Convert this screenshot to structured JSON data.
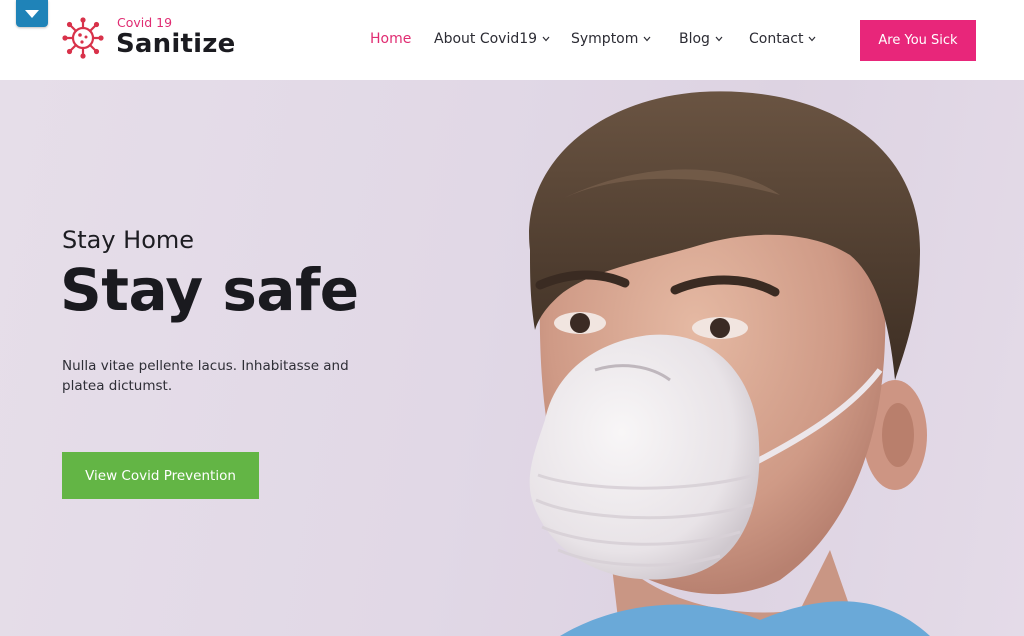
{
  "brand": {
    "subtitle": "Covid 19",
    "name": "Sanitize",
    "accent_color": "#e02c72",
    "icon": "virus-logo-icon"
  },
  "top_toggle": {
    "icon": "caret-down-icon",
    "color": "#1f83b8"
  },
  "nav": {
    "items": [
      {
        "label": "Home",
        "active": true,
        "has_dropdown": false
      },
      {
        "label": "About Covid19",
        "active": false,
        "has_dropdown": true
      },
      {
        "label": "Symptom",
        "active": false,
        "has_dropdown": true
      },
      {
        "label": "Blog",
        "active": false,
        "has_dropdown": true
      },
      {
        "label": "Contact",
        "active": false,
        "has_dropdown": true
      }
    ],
    "cta_label": "Are You Sick",
    "cta_color": "#e8267a"
  },
  "hero": {
    "overline": "Stay Home",
    "title": "Stay safe",
    "description": "Nulla vitae pellente lacus. Inhabitasse and platea dictumst.",
    "button_label": "View Covid Prevention",
    "button_color": "#63b545",
    "image": "person-wearing-face-mask-photo"
  }
}
